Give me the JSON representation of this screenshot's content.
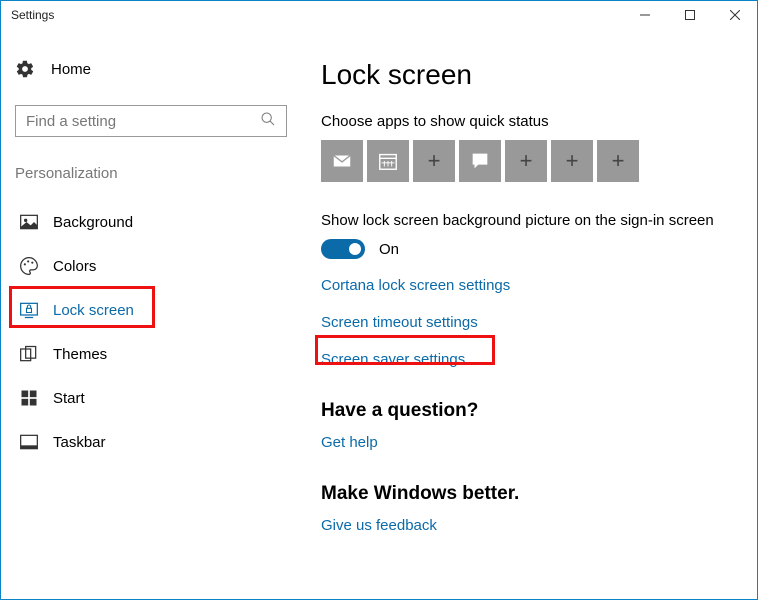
{
  "window": {
    "title": "Settings"
  },
  "sidebar": {
    "home_label": "Home",
    "search_placeholder": "Find a setting",
    "category_label": "Personalization",
    "items": [
      {
        "label": "Background"
      },
      {
        "label": "Colors"
      },
      {
        "label": "Lock screen"
      },
      {
        "label": "Themes"
      },
      {
        "label": "Start"
      },
      {
        "label": "Taskbar"
      }
    ]
  },
  "main": {
    "title": "Lock screen",
    "quick_status_label": "Choose apps to show quick status",
    "show_bg_label": "Show lock screen background picture on the sign-in screen",
    "toggle_state": "On",
    "links": {
      "cortana": "Cortana lock screen settings",
      "timeout": "Screen timeout settings",
      "screensaver": "Screen saver settings"
    },
    "question_hdr": "Have a question?",
    "get_help": "Get help",
    "better_hdr": "Make Windows better.",
    "feedback": "Give us feedback"
  }
}
